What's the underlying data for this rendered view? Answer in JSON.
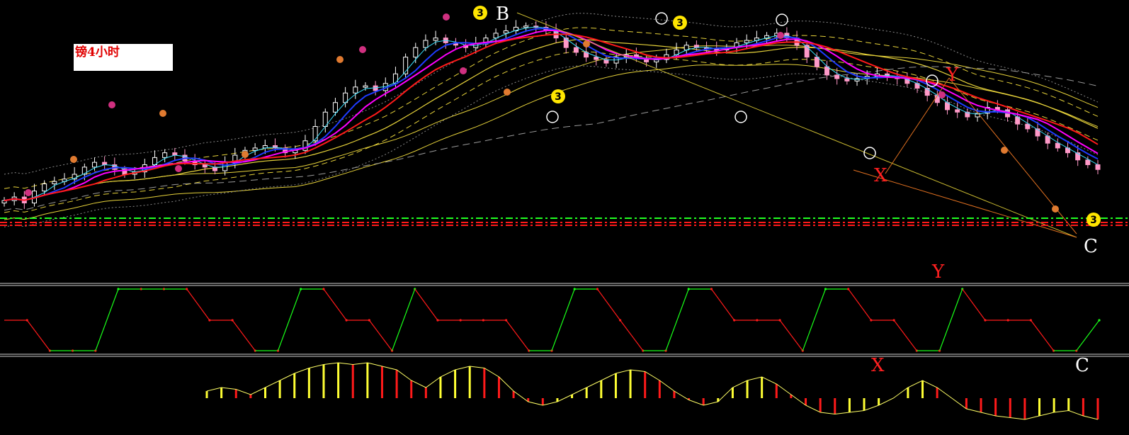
{
  "title": "镑4小时",
  "colors": {
    "background": "#000000",
    "ma_fast": "#1f3bff",
    "ma_mid": "#ff00ff",
    "ma_slow": "#ff1a1a",
    "ma_cyan": "#36e0ff",
    "envelope": "#e6d23a",
    "candle_up": "#ffffff",
    "candle_down": "#ff99c8",
    "support_green": "#22ff22",
    "support_red": "#ff1a1a",
    "osc_up": "#18ff18",
    "osc_down": "#ff1a1a",
    "hist_yellow": "#ffff33",
    "hist_red": "#ff1a1a"
  },
  "wave_labels": [
    {
      "text": "B",
      "color": "white"
    },
    {
      "text": "Y",
      "color": "red"
    },
    {
      "text": "X",
      "color": "red"
    },
    {
      "text": "C",
      "color": "white"
    }
  ],
  "oscillator_labels": [
    {
      "text": "Y",
      "color": "red"
    },
    {
      "text": "X",
      "color": "red"
    },
    {
      "text": "C",
      "color": "white"
    }
  ],
  "badge_text": "3",
  "chart_data": [
    {
      "type": "candlestick",
      "title": "镑4小时",
      "series_names": [],
      "close_values": [
        30,
        33,
        28,
        38,
        44,
        46,
        48,
        52,
        58,
        62,
        60,
        56,
        52,
        54,
        60,
        66,
        70,
        68,
        63,
        60,
        58,
        55,
        62,
        68,
        72,
        74,
        76,
        74,
        70,
        72,
        80,
        92,
        104,
        112,
        120,
        125,
        126,
        122,
        128,
        136,
        150,
        158,
        164,
        166,
        162,
        160,
        158,
        161,
        166,
        170,
        172,
        175,
        176,
        175,
        172,
        166,
        158,
        154,
        150,
        148,
        145,
        150,
        152,
        149,
        146,
        148,
        152,
        156,
        160,
        158,
        157,
        156,
        158,
        162,
        164,
        166,
        168,
        170,
        166,
        160,
        150,
        142,
        135,
        132,
        130,
        132,
        134,
        136,
        134,
        132,
        128,
        124,
        118,
        112,
        106,
        104,
        100,
        103,
        108,
        106,
        100,
        94,
        90,
        84,
        78,
        74,
        70,
        64,
        60,
        56
      ]
    },
    {
      "type": "line",
      "series_names": [],
      "step_values": [
        0,
        0,
        -1,
        -1,
        -1,
        1,
        1,
        1,
        1,
        0,
        0,
        -1,
        -1,
        1,
        1,
        0,
        0,
        -1,
        1,
        0,
        0,
        0,
        0,
        -1,
        -1,
        1,
        1,
        0,
        -1,
        -1,
        1,
        1,
        0,
        0,
        0,
        -1,
        1,
        1,
        0,
        0,
        -1,
        -1,
        1,
        0,
        0,
        0,
        -1,
        -1,
        0
      ]
    },
    {
      "type": "bar",
      "series_names": [],
      "values": [
        0.2,
        0.3,
        0.25,
        0.1,
        0.3,
        0.5,
        0.7,
        0.85,
        0.95,
        1.0,
        0.95,
        1.0,
        0.9,
        0.8,
        0.5,
        0.3,
        0.6,
        0.8,
        0.9,
        0.85,
        0.6,
        0.2,
        -0.1,
        -0.2,
        -0.1,
        0.1,
        0.3,
        0.5,
        0.7,
        0.8,
        0.75,
        0.5,
        0.2,
        -0.05,
        -0.2,
        -0.1,
        0.3,
        0.5,
        0.6,
        0.4,
        0.1,
        -0.2,
        -0.4,
        -0.45,
        -0.4,
        -0.35,
        -0.2,
        0.0,
        0.3,
        0.5,
        0.3,
        0.0,
        -0.3,
        -0.4,
        -0.5,
        -0.55,
        -0.6,
        -0.5,
        -0.4,
        -0.35,
        -0.5,
        -0.6
      ]
    }
  ]
}
